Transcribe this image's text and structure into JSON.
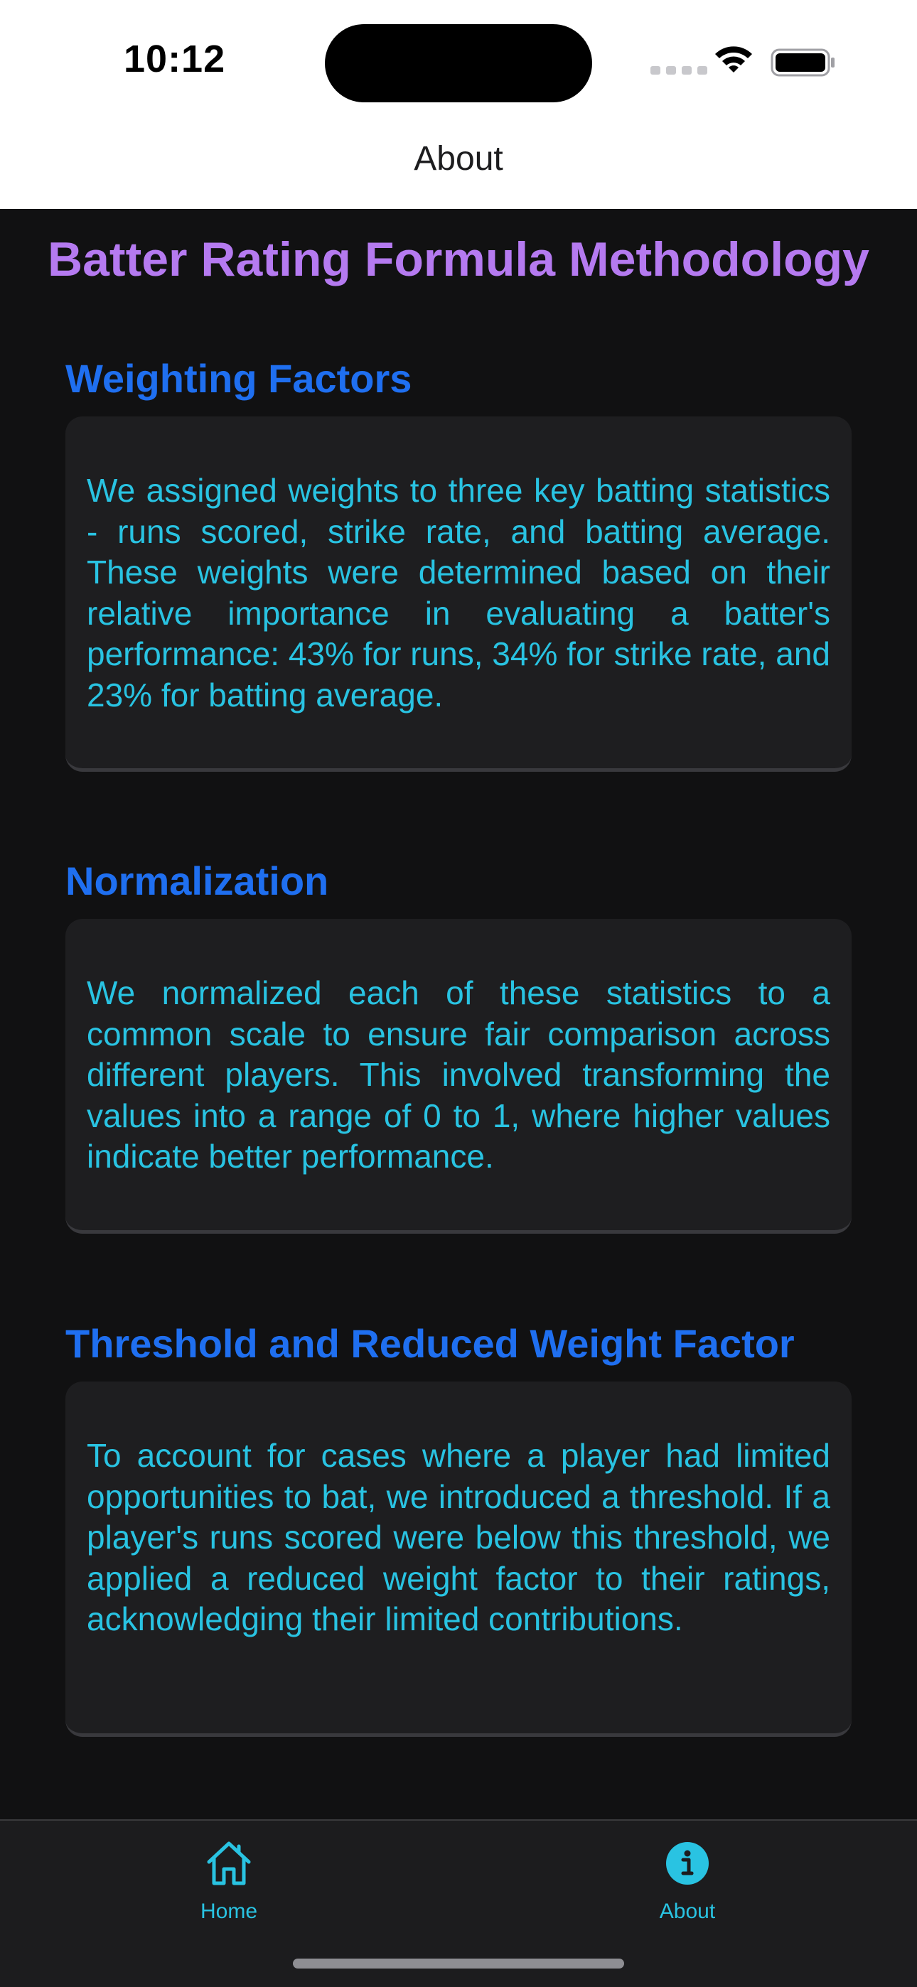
{
  "status_bar": {
    "time": "10:12"
  },
  "nav": {
    "title": "About"
  },
  "page": {
    "title": "Batter Rating Formula Methodology"
  },
  "sections": [
    {
      "heading": "Weighting Factors",
      "body": "We assigned weights to three key batting statistics - runs scored, strike rate, and batting average. These weights were determined based on their relative importance in evaluating a batter's performance: 43% for runs, 34% for strike rate, and 23% for batting average."
    },
    {
      "heading": "Normalization",
      "body": "We normalized each of these statistics to a common scale to ensure fair comparison across different players. This involved transforming the values into a range of 0 to 1, where higher values indicate better performance."
    },
    {
      "heading": "Threshold and Reduced Weight Factor",
      "body": "To account for cases where a player had limited opportunities to bat, we introduced a threshold. If a player's runs scored were below this threshold, we applied a reduced weight factor to their ratings, acknowledging their limited contributions."
    }
  ],
  "tabbar": {
    "tabs": [
      {
        "label": "Home",
        "icon": "house-icon"
      },
      {
        "label": "About",
        "icon": "info-circle-icon"
      }
    ]
  },
  "colors": {
    "title": "#b57af0",
    "heading": "#1f6ff0",
    "body_text": "#29c3e2",
    "card": "#1e1e20",
    "background": "#111112"
  }
}
